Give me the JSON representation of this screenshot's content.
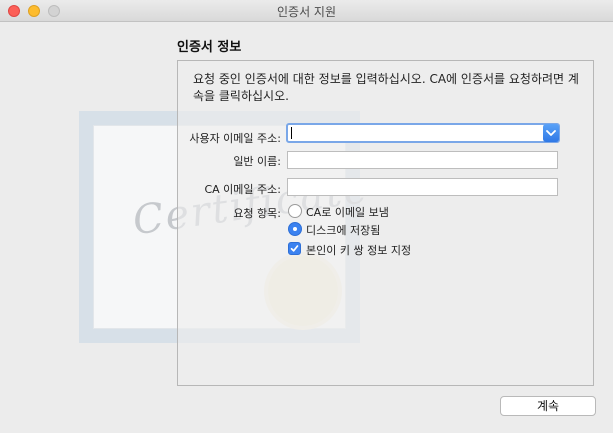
{
  "window": {
    "title": "인증서 지원"
  },
  "section": {
    "title": "인증서 정보"
  },
  "description": "요청 중인 인증서에 대한 정보를 입력하십시오. CA에 인증서를 요청하려면 계속을 클릭하십시오.",
  "background": {
    "certificate_text": "Certificate"
  },
  "form": {
    "email_label": "사용자 이메일 주소:",
    "email_value": "",
    "name_label": "일반 이름:",
    "name_value": "",
    "ca_email_label": "CA 이메일 주소:",
    "ca_email_value": "",
    "request_label": "요청 항목:",
    "options": [
      {
        "label": "CA로 이메일 보냄",
        "type": "radio",
        "selected": false
      },
      {
        "label": "디스크에 저장됨",
        "type": "radio",
        "selected": true
      },
      {
        "label": "본인이 키 쌍 정보 지정",
        "type": "checkbox",
        "checked": true
      }
    ]
  },
  "buttons": {
    "continue": "계속"
  },
  "colors": {
    "accent": "#3b82f0",
    "close": "#fc5f57",
    "minimize": "#fdbc2e"
  }
}
